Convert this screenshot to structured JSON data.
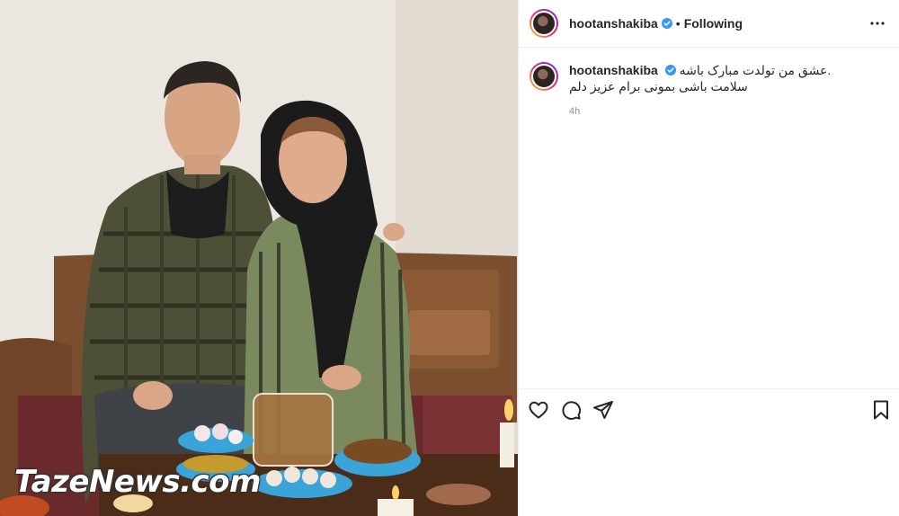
{
  "post": {
    "username": "hootanshakiba",
    "follow_status": "Following",
    "separator": "•",
    "caption_line1": "عشق من تولدت مبارک باشه.",
    "caption_line2": "سلامت باشی بمونی برام عزیز دلم",
    "timestamp": "4h"
  },
  "watermark": "TazeNews.com",
  "icons": {
    "verified": "verified-badge-icon",
    "more": "more-options-icon",
    "like": "heart-icon",
    "comment": "comment-icon",
    "share": "share-icon",
    "save": "bookmark-icon"
  },
  "colors": {
    "verified_blue": "#3897f0",
    "text": "#262626",
    "muted": "#8e8e8e",
    "divider": "#efefef"
  }
}
